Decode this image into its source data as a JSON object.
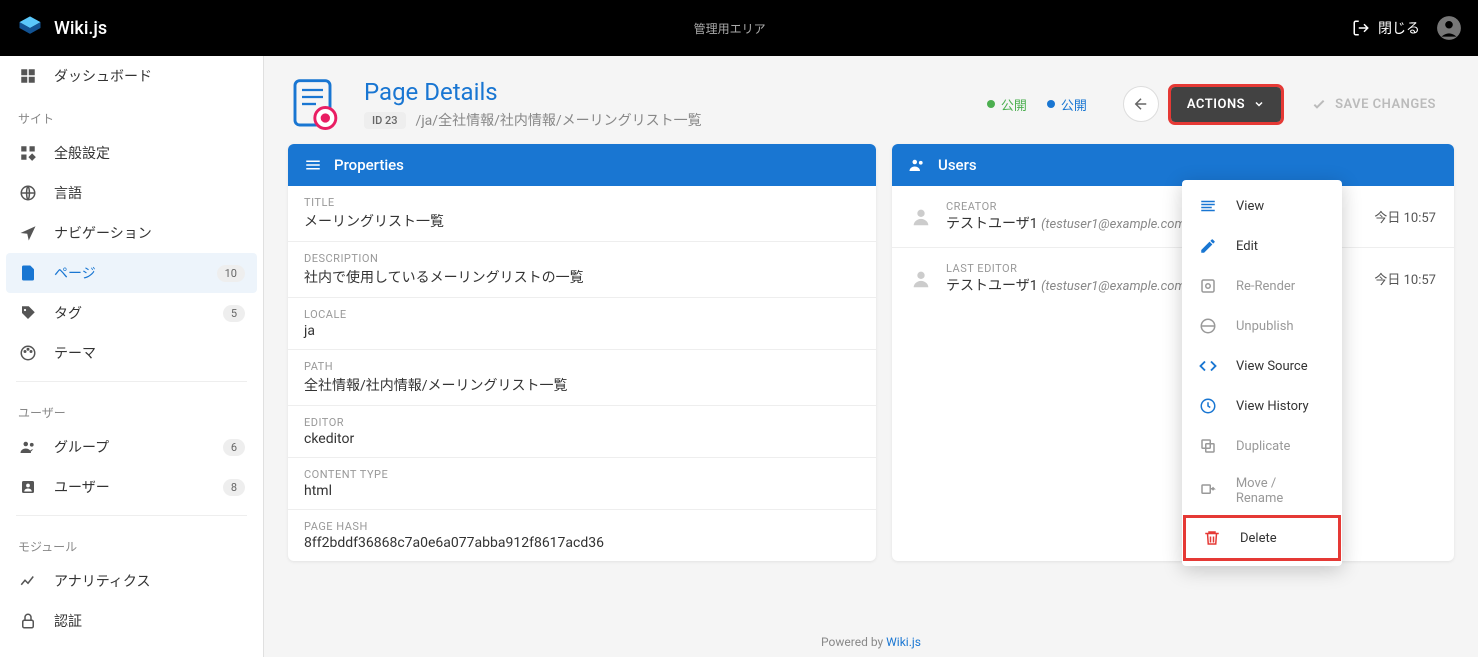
{
  "app": {
    "name": "Wiki.js",
    "center_label": "管理用エリア",
    "close_label": "閉じる"
  },
  "sidebar": {
    "items": [
      {
        "label": "ダッシュボード"
      }
    ],
    "group_site": "サイト",
    "site_items": [
      {
        "label": "全般設定"
      },
      {
        "label": "言語"
      },
      {
        "label": "ナビゲーション"
      },
      {
        "label": "ページ",
        "badge": "10"
      },
      {
        "label": "タグ",
        "badge": "5"
      },
      {
        "label": "テーマ"
      }
    ],
    "group_users": "ユーザー",
    "user_items": [
      {
        "label": "グループ",
        "badge": "6"
      },
      {
        "label": "ユーザー",
        "badge": "8"
      }
    ],
    "group_modules": "モジュール",
    "module_items": [
      {
        "label": "アナリティクス"
      },
      {
        "label": "認証"
      }
    ]
  },
  "page": {
    "title": "Page Details",
    "id_chip": "ID 23",
    "path": "/ja/全社情報/社内情報/メーリングリスト一覧",
    "status_green": "公開",
    "status_blue": "公開",
    "actions_label": "ACTIONS",
    "save_label": "SAVE CHANGES"
  },
  "properties": {
    "header": "Properties",
    "rows": [
      {
        "label": "TITLE",
        "value": "メーリングリスト一覧"
      },
      {
        "label": "DESCRIPTION",
        "value": "社内で使用しているメーリングリストの一覧"
      },
      {
        "label": "LOCALE",
        "value": "ja"
      },
      {
        "label": "PATH",
        "value": "全社情報/社内情報/メーリングリスト一覧"
      },
      {
        "label": "EDITOR",
        "value": "ckeditor"
      },
      {
        "label": "CONTENT TYPE",
        "value": "html"
      },
      {
        "label": "PAGE HASH",
        "value": "8ff2bddf36868c7a0e6a077abba912f8617acd36"
      }
    ]
  },
  "users": {
    "header": "Users",
    "rows": [
      {
        "label": "CREATOR",
        "name": "テストユーザ1",
        "email": "(testuser1@example.com)",
        "time": "今日 10:57"
      },
      {
        "label": "LAST EDITOR",
        "name": "テストユーザ1",
        "email": "(testuser1@example.com)",
        "time": "今日 10:57"
      }
    ]
  },
  "menu": {
    "view": "View",
    "edit": "Edit",
    "rerender": "Re-Render",
    "unpublish": "Unpublish",
    "source": "View Source",
    "history": "View History",
    "duplicate": "Duplicate",
    "move": "Move / Rename",
    "delete": "Delete"
  },
  "footer": {
    "text": "Powered by ",
    "link": "Wiki.js"
  },
  "colors": {
    "primary": "#1976d2",
    "green": "#4caf50",
    "red": "#e53935"
  }
}
